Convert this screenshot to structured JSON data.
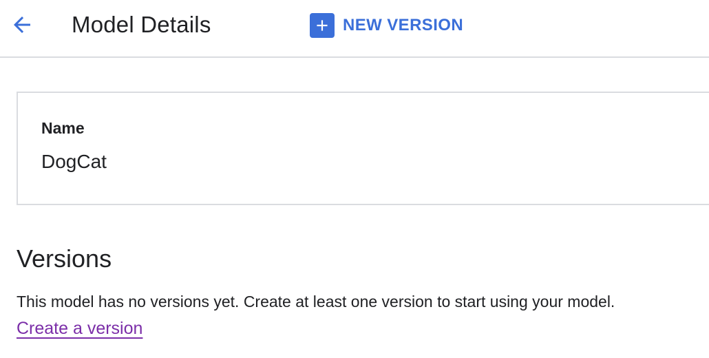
{
  "colors": {
    "accent": "#3b6fd9",
    "link": "#7b2ea8"
  },
  "header": {
    "back_icon": "arrow-back-icon",
    "title": "Model Details",
    "new_version_icon": "plus-icon",
    "new_version_label": "NEW VERSION"
  },
  "details": {
    "name_label": "Name",
    "name_value": "DogCat"
  },
  "versions": {
    "heading": "Versions",
    "empty_message": "This model has no versions yet. Create at least one version to start using your model.",
    "create_link": "Create a version"
  }
}
